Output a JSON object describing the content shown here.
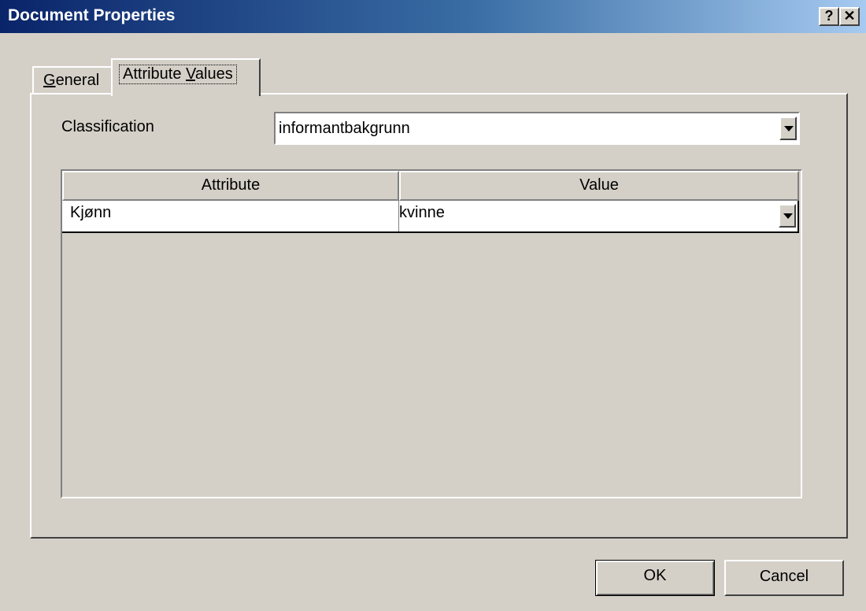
{
  "window": {
    "title": "Document Properties",
    "help_button": "?",
    "close_button": "✕"
  },
  "tabs": [
    {
      "label_pre": "",
      "label_mnemonic": "G",
      "label_post": "eneral",
      "selected": false
    },
    {
      "label_pre": "Attribute ",
      "label_mnemonic": "V",
      "label_post": "alues",
      "selected": true
    }
  ],
  "classification": {
    "label": "Classification",
    "value": "informantbakgrunn"
  },
  "grid": {
    "columns": [
      "Attribute",
      "Value"
    ],
    "rows": [
      {
        "attribute": "Kjønn",
        "value": "kvinne"
      }
    ]
  },
  "buttons": {
    "ok": "OK",
    "cancel": "Cancel"
  },
  "colors": {
    "title_start": "#0a246a",
    "title_end": "#a6caf0",
    "face": "#d4d0c8"
  }
}
